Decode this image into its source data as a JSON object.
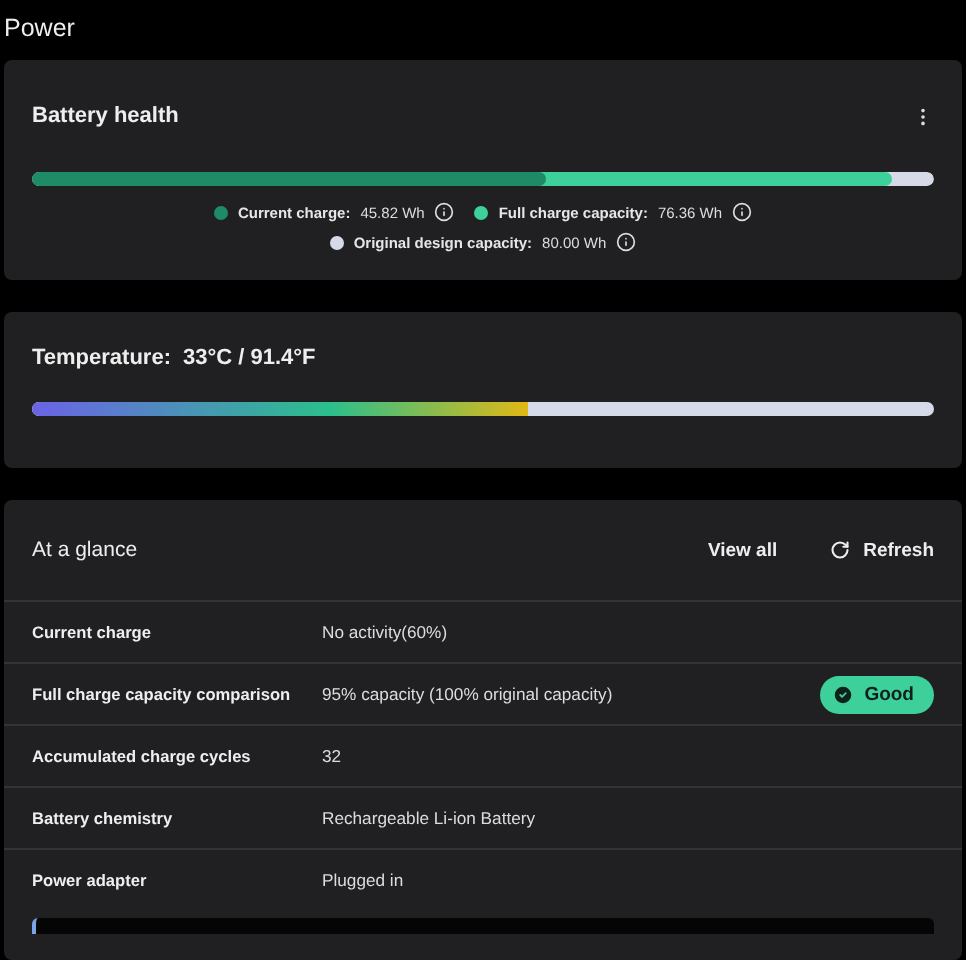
{
  "page_title": "Power",
  "battery_health": {
    "title": "Battery health",
    "legend": [
      {
        "label": "Current charge:",
        "value": "45.82 Wh",
        "color": "#1e8a66",
        "level": 0.57
      },
      {
        "label": "Full charge capacity:",
        "value": "76.36 Wh",
        "color": "#3ed09a",
        "level": 0.954
      },
      {
        "label": "Original design capacity:",
        "value": "80.00 Wh",
        "color": "#d6d9e8",
        "level": 1
      }
    ]
  },
  "temperature": {
    "label": "Temperature:",
    "value": "33°C / 91.4°F",
    "level": 0.55
  },
  "at_a_glance": {
    "title": "At a glance",
    "actions": [
      "View all",
      "Refresh"
    ],
    "rows": [
      {
        "label": "Current charge",
        "value": "No activity(60%)"
      },
      {
        "label": "Full charge capacity comparison",
        "value": "95% capacity (100% original capacity)",
        "badge": "Good"
      },
      {
        "label": "Accumulated charge cycles",
        "value": "32"
      },
      {
        "label": "Battery chemistry",
        "value": "Rechargeable Li-ion Battery"
      },
      {
        "label": "Power adapter",
        "value": "Plugged in"
      }
    ]
  }
}
